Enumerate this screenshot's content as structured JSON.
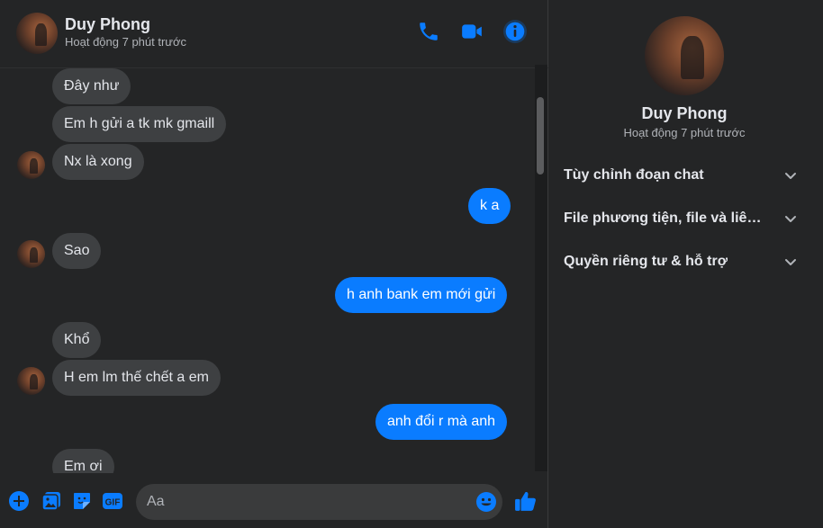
{
  "contact": {
    "name": "Duy Phong",
    "status": "Hoạt động 7 phút trước"
  },
  "colors": {
    "accent": "#0a7cff",
    "incoming_bubble": "#3e4042",
    "background": "#242526"
  },
  "header_icons": [
    "phone-icon",
    "video-camera-icon",
    "info-icon"
  ],
  "messages": [
    {
      "text": "Đây như",
      "side": "in"
    },
    {
      "text": "Em h gửi a tk mk gmaill",
      "side": "in"
    },
    {
      "text": "Nx là xong",
      "side": "in"
    },
    {
      "text": "k a",
      "side": "out"
    },
    {
      "text": "Sao",
      "side": "in"
    },
    {
      "text": "h anh bank em mới gửi",
      "side": "out"
    },
    {
      "text": "Khổ",
      "side": "in"
    },
    {
      "text": "H em lm thế chết a em",
      "side": "in"
    },
    {
      "text": "anh đổi r mà anh",
      "side": "out"
    },
    {
      "text": "Em ơi",
      "side": "in"
    }
  ],
  "composer": {
    "placeholder": "Aa",
    "icons": [
      "plus-icon",
      "image-icon",
      "sticker-icon",
      "gif-icon",
      "emoji-icon",
      "thumbs-up-icon"
    ],
    "gif_label": "GIF"
  },
  "sidebar": {
    "items": [
      {
        "label": "Tùy chỉnh đoạn chat"
      },
      {
        "label": "File phương tiện, file và liên kết"
      },
      {
        "label": "Quyền riêng tư & hỗ trợ"
      }
    ]
  }
}
